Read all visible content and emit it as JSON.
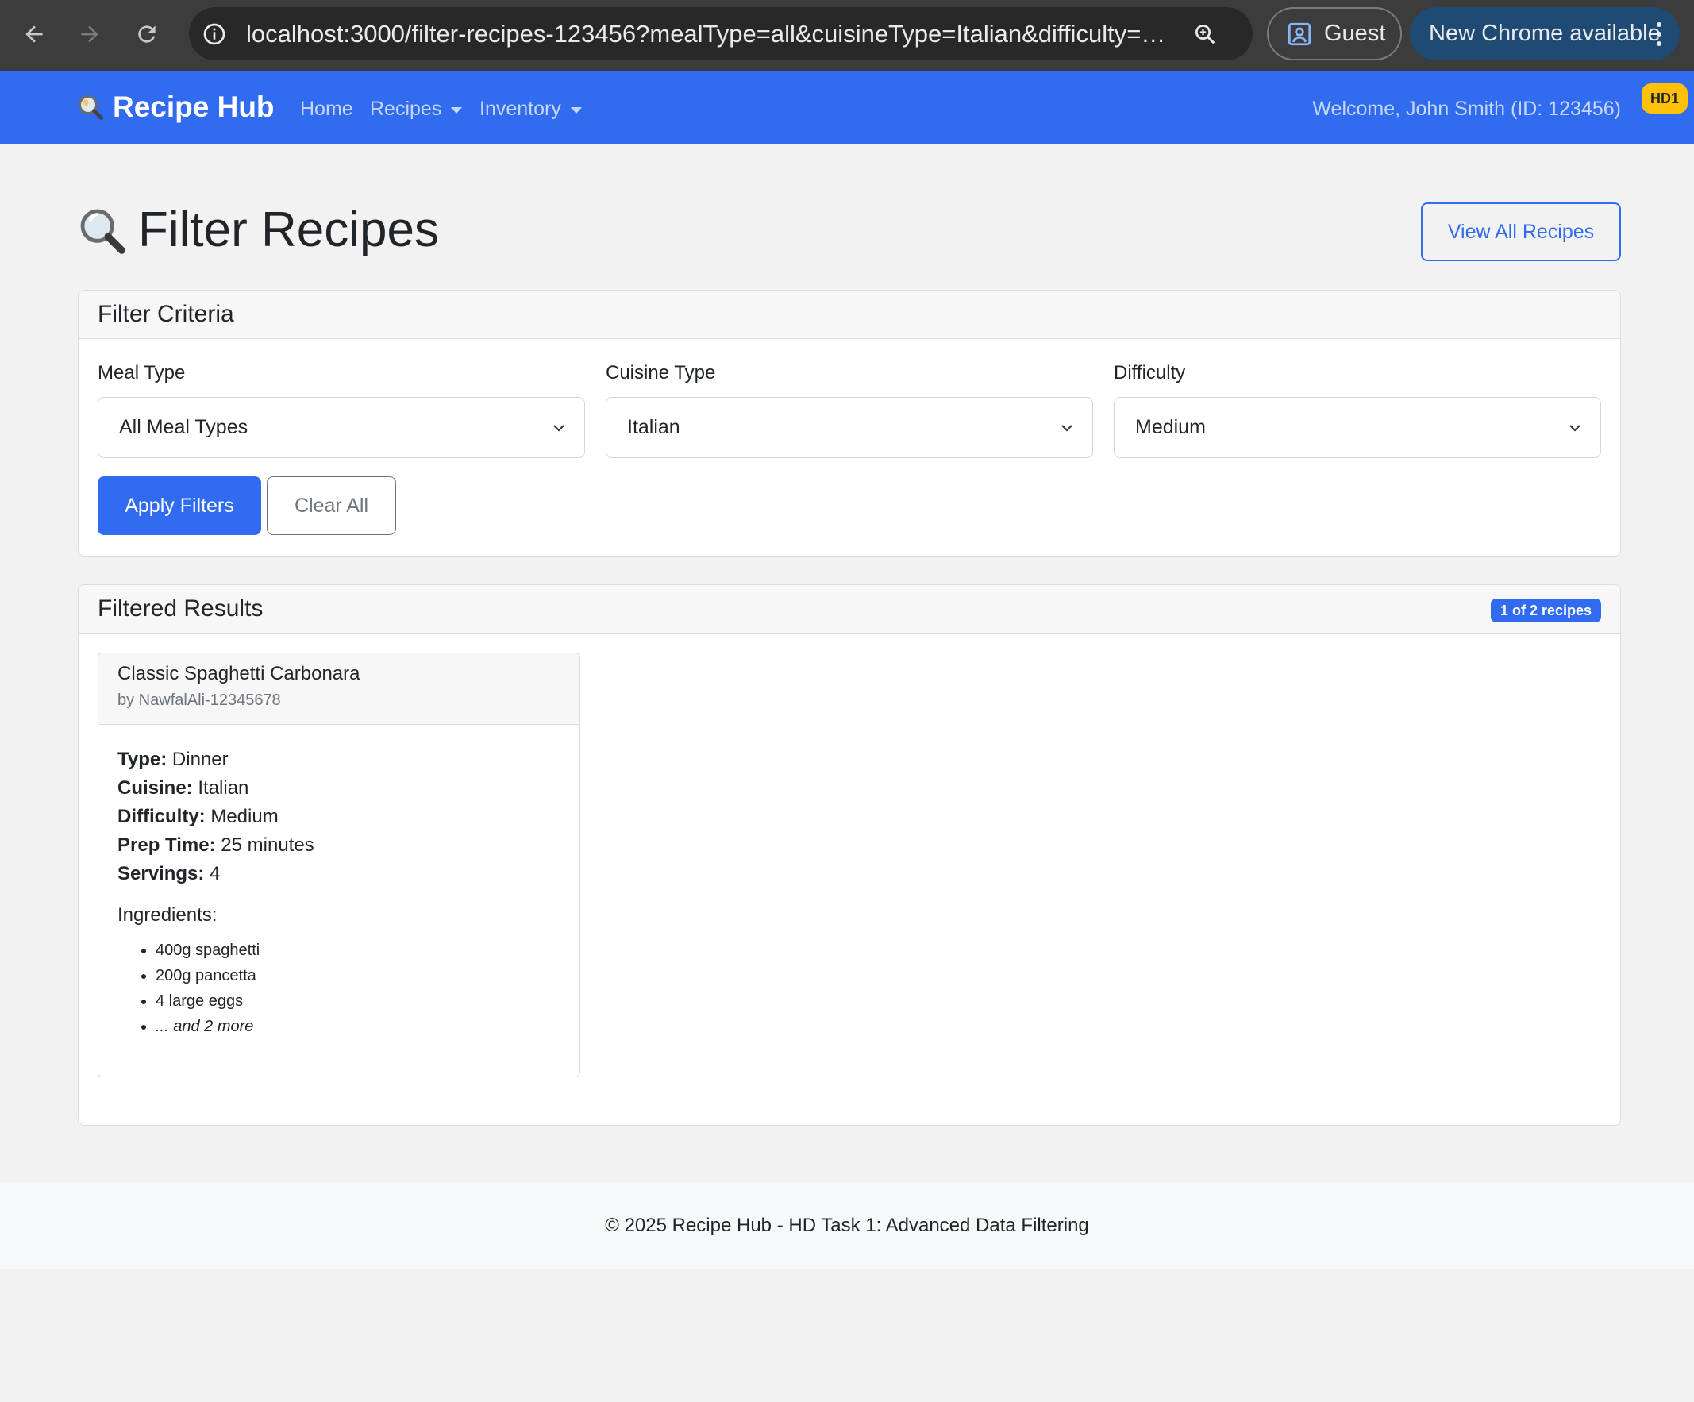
{
  "browser": {
    "url": "localhost:3000/filter-recipes-123456?mealType=all&cuisineType=Italian&difficulty=Me...",
    "profile_label": "Guest",
    "update_label": "New Chrome available",
    "icons": [
      "back-arrow-icon",
      "forward-arrow-icon",
      "reload-icon",
      "site-info-icon",
      "zoom-icon",
      "profile-icon",
      "more-menu-icon"
    ]
  },
  "navbar": {
    "brand": "Recipe Hub",
    "brand_icon": "magnifier-icon",
    "links": {
      "home": "Home",
      "recipes": "Recipes",
      "inventory": "Inventory"
    },
    "welcome": "Welcome, John Smith (ID: 123456)",
    "badge": "HD1",
    "color": "#316bf0"
  },
  "page": {
    "title": "Filter Recipes",
    "view_all_label": "View All Recipes"
  },
  "filters": {
    "header": "Filter Criteria",
    "meal_type": {
      "label": "Meal Type",
      "value": "All Meal Types"
    },
    "cuisine_type": {
      "label": "Cuisine Type",
      "value": "Italian"
    },
    "difficulty": {
      "label": "Difficulty",
      "value": "Medium"
    },
    "apply_label": "Apply Filters",
    "clear_label": "Clear All"
  },
  "results": {
    "header": "Filtered Results",
    "count_badge": "1 of 2 recipes",
    "recipes": [
      {
        "title": "Classic Spaghetti Carbonara",
        "author": "by NawfalAli-12345678",
        "type_label": "Type:",
        "type": "Dinner",
        "cuisine_label": "Cuisine:",
        "cuisine": "Italian",
        "difficulty_label": "Difficulty:",
        "difficulty": "Medium",
        "prep_label": "Prep Time:",
        "prep": "25 minutes",
        "servings_label": "Servings:",
        "servings": "4",
        "ingredients_title": "Ingredients:",
        "ingredients": [
          "400g spaghetti",
          "200g pancetta",
          "4 large eggs",
          "... and 2 more"
        ]
      }
    ]
  },
  "footer": {
    "text": "© 2025 Recipe Hub - HD Task 1: Advanced Data Filtering"
  }
}
